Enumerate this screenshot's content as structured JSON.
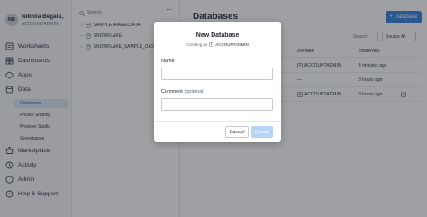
{
  "user": {
    "initials": "NB",
    "name": "Nikhila Bejjala",
    "role": "ACCOUNTADMIN"
  },
  "nav": {
    "items": [
      {
        "label": "Worksheets",
        "icon": "worksheet-icon"
      },
      {
        "label": "Dashboards",
        "icon": "dashboard-icon"
      },
      {
        "label": "Apps",
        "icon": "apps-icon"
      },
      {
        "label": "Data",
        "icon": "data-icon"
      },
      {
        "label": "Marketplace",
        "icon": "marketplace-icon"
      },
      {
        "label": "Activity",
        "icon": "activity-icon"
      },
      {
        "label": "Admin",
        "icon": "admin-icon"
      },
      {
        "label": "Help & Support",
        "icon": "help-icon"
      }
    ],
    "data_subitems": [
      {
        "label": "Databases",
        "active": true
      },
      {
        "label": "Private Sharing",
        "active": false
      },
      {
        "label": "Provider Studio",
        "active": false
      },
      {
        "label": "Governance",
        "active": false
      }
    ]
  },
  "tree": {
    "search_label": "Search",
    "databases": [
      "SAMPLETRAVELDATA",
      "SNOWFLAKE",
      "SNOWFLAKE_SAMPLE_DATA"
    ]
  },
  "main": {
    "title": "Databases",
    "add_button": "+ Database",
    "search_label": "Search",
    "filter_label": "Source All",
    "columns": {
      "owner": "OWNER",
      "created": "CREATED"
    },
    "rows": [
      {
        "owner": "ACCOUNTADMIN",
        "created": "4 minutes ago"
      },
      {
        "owner": "—",
        "created": "8 hours ago"
      },
      {
        "owner": "ACCOUNTADMIN",
        "created": "8 hours ago"
      }
    ]
  },
  "modal": {
    "title": "New Database",
    "subtitle_prefix": "Creating as",
    "role": "ACCOUNTADMIN",
    "name_label": "Name",
    "name_value": "",
    "comment_label": "Comment",
    "comment_optional": "(optional)",
    "comment_value": "",
    "cancel_label": "Cancel",
    "create_label": "Create"
  },
  "colors": {
    "accent": "#2a7ad9",
    "active_bg": "#d7e6fb",
    "disabled_button": "#b8d3f5"
  }
}
